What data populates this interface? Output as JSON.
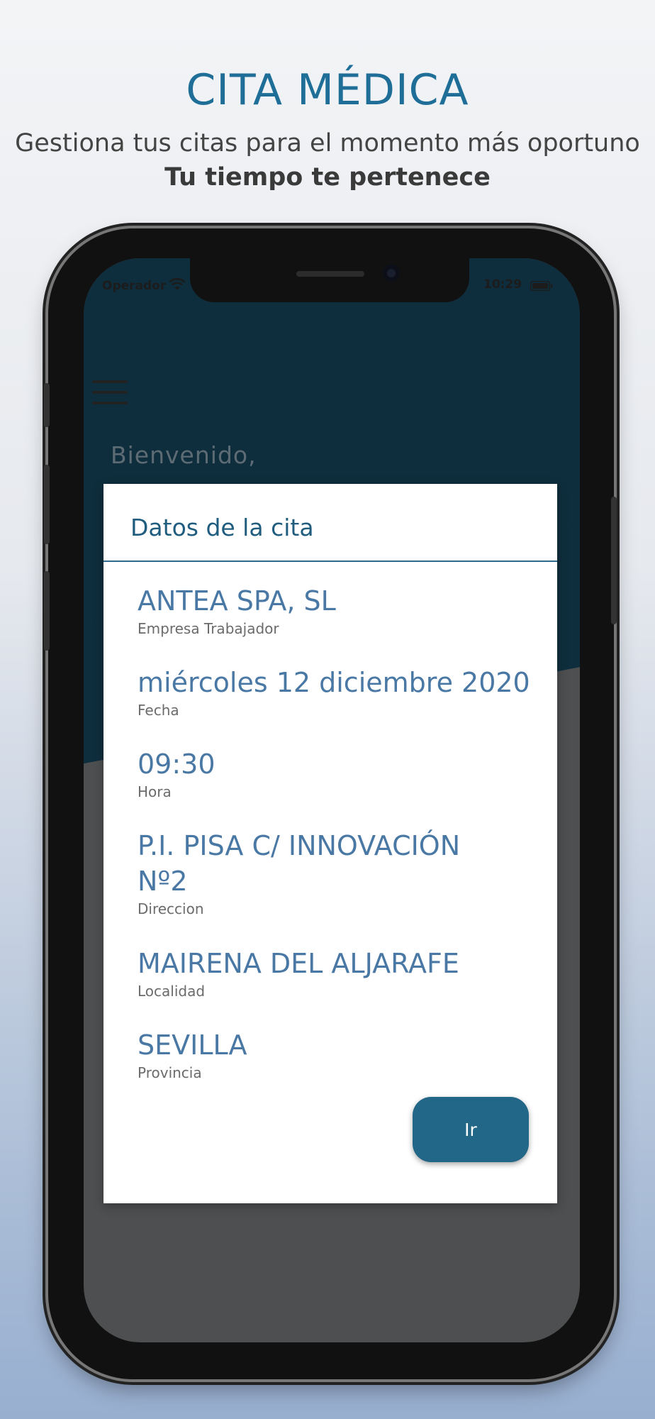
{
  "promo": {
    "headline": "CITA MÉDICA",
    "tagline": "Gestiona tus citas para el momento más oportuno",
    "tagline_strong": "Tu tiempo te pertenece"
  },
  "status_bar": {
    "carrier": "Operador",
    "time": "10:29",
    "wifi_icon": "wifi-icon",
    "battery_icon": "battery-icon"
  },
  "app": {
    "menu_icon": "hamburger-menu-icon",
    "welcome": "Bienvenido,"
  },
  "dialog": {
    "title": "Datos de la cita",
    "fields": [
      {
        "value": "ANTEA SPA, SL",
        "label": "Empresa Trabajador"
      },
      {
        "value": "miércoles 12 diciembre 2020",
        "label": "Fecha"
      },
      {
        "value": "09:30",
        "label": "Hora"
      },
      {
        "value": "P.I. PISA C/ INNOVACIÓN",
        "value_line2": "Nº2",
        "label": "Direccion"
      },
      {
        "value": "MAIRENA DEL ALJARAFE",
        "label": "Localidad"
      },
      {
        "value": "SEVILLA",
        "label": "Provincia"
      }
    ],
    "action_label": "Ir"
  },
  "colors": {
    "accent": "#226788",
    "headline": "#1e6e98",
    "app_header": "#0f2e3d"
  }
}
